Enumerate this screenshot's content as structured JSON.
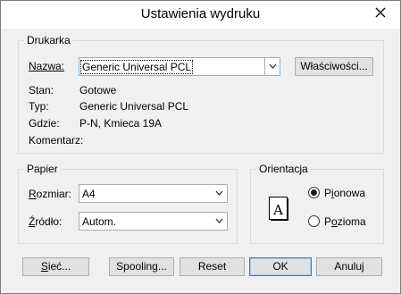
{
  "window": {
    "title": "Ustawienia wydruku"
  },
  "printer": {
    "group_label": "Drukarka",
    "name_label": "Nazwa:",
    "name_value": "Generic Universal PCL",
    "properties_button": "Właściwości...",
    "status_label": "Stan:",
    "status_value": "Gotowe",
    "type_label": "Typ:",
    "type_value": "Generic Universal PCL",
    "where_label": "Gdzie:",
    "where_value": "P-N, Kmieca 19A",
    "comment_label": "Komentarz:",
    "comment_value": ""
  },
  "paper": {
    "group_label": "Papier",
    "size_label": "Rozmiar:",
    "size_value": "A4",
    "source_label": "Źródło:",
    "source_value": "Autom."
  },
  "orientation": {
    "group_label": "Orientacja",
    "icon_letter": "A",
    "portrait_label": "Pionowa",
    "landscape_label": "Pozioma",
    "selected": "Pionowa"
  },
  "buttons": {
    "network": "Sieć...",
    "spooling": "Spooling...",
    "reset": "Reset",
    "ok": "OK",
    "cancel": "Anuluj"
  },
  "icons": {
    "close": "close-icon",
    "dropdown": "chevron-down-icon",
    "orientation": "portrait-page-icon"
  }
}
